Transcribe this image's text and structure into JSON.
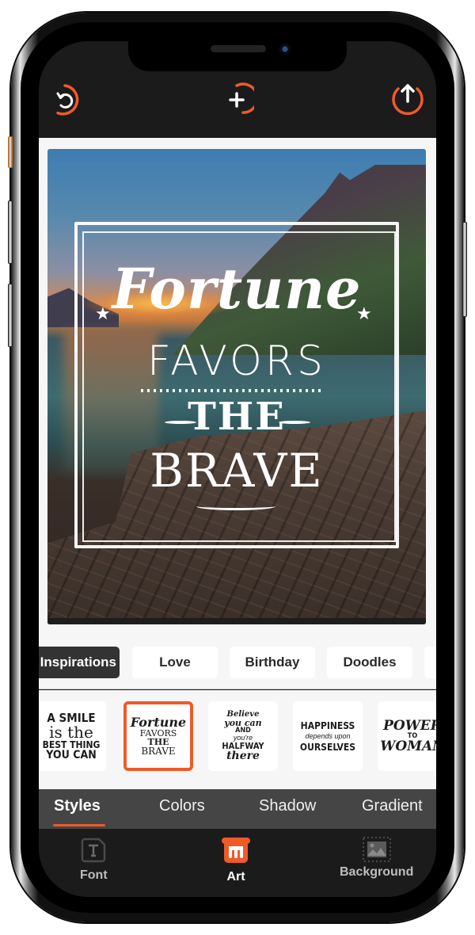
{
  "colors": {
    "accent": "#f05a28",
    "screen_bg": "#1b1b1b",
    "panel_bg": "#f6f6f6",
    "subtab_bg": "#454545",
    "active_chip_bg": "#333333"
  },
  "toolbar": {
    "reset": {
      "icon": "rotate-ccw-icon",
      "label": "Reset"
    },
    "add": {
      "icon": "plus-icon",
      "label": "Add"
    },
    "share": {
      "icon": "upload-arrow-icon",
      "label": "Share"
    }
  },
  "poster": {
    "background": "mountain lake at sunset with rocky shore",
    "quote": {
      "line1": "Fortune",
      "line2": "FAVORS",
      "line3": "THE",
      "line4": "BRAVE",
      "star": "★"
    }
  },
  "categories": [
    {
      "label": "Inspirations",
      "active": true
    },
    {
      "label": "Love",
      "active": false
    },
    {
      "label": "Birthday",
      "active": false
    },
    {
      "label": "Doodles",
      "active": false
    }
  ],
  "templates": [
    {
      "lines": [
        "A SMILE",
        "is the",
        "BEST THING",
        "YOU CAN"
      ],
      "selected": false
    },
    {
      "lines": [
        "Fortune",
        "FAVORS",
        "THE",
        "BRAVE"
      ],
      "selected": true
    },
    {
      "lines": [
        "Believe",
        "you can",
        "AND",
        "you're",
        "HALFWAY",
        "there"
      ],
      "selected": false
    },
    {
      "lines": [
        "HAPPINESS",
        "depends upon",
        "OURSELVES"
      ],
      "selected": false
    },
    {
      "lines": [
        "POWER",
        "TO",
        "WOMAN"
      ],
      "selected": false
    }
  ],
  "sub_tabs": [
    {
      "label": "Styles",
      "active": true
    },
    {
      "label": "Colors",
      "active": false
    },
    {
      "label": "Shadow",
      "active": false
    },
    {
      "label": "Gradient",
      "active": false
    }
  ],
  "bottom_nav": [
    {
      "label": "Font",
      "icon": "font-file-icon",
      "active": false
    },
    {
      "label": "Art",
      "icon": "paint-bucket-icon",
      "active": true
    },
    {
      "label": "Background",
      "icon": "image-frame-icon",
      "active": false
    }
  ]
}
